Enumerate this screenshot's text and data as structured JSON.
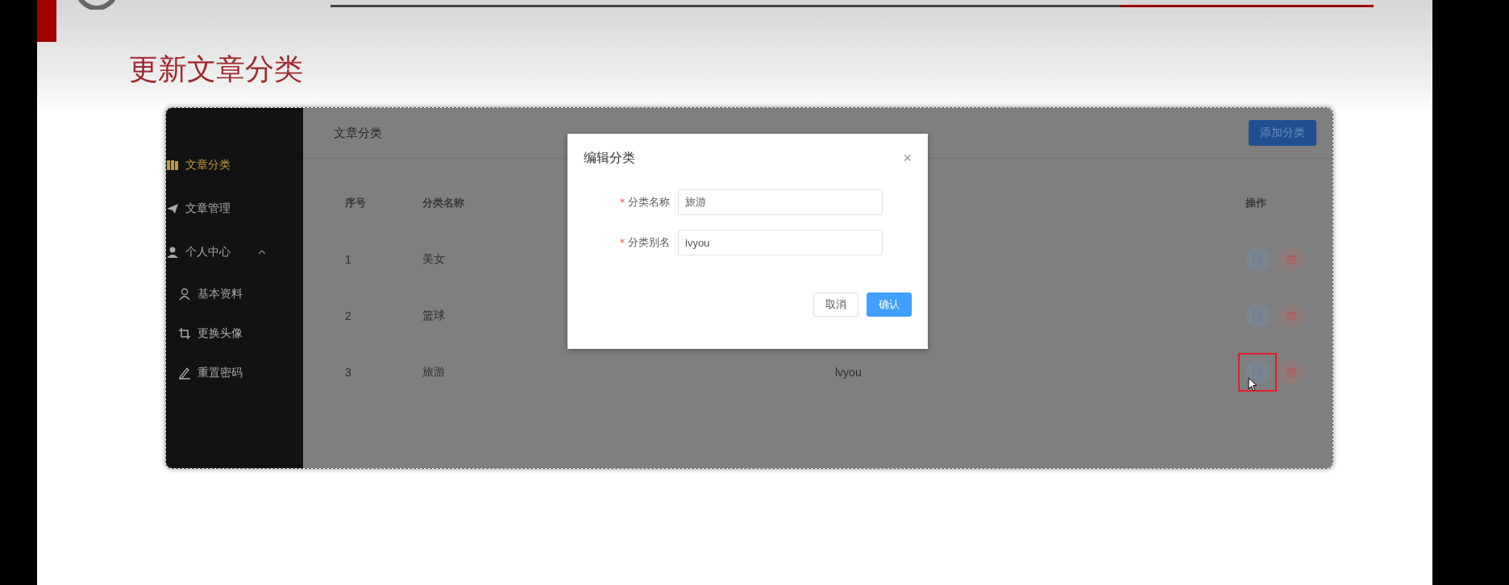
{
  "slide": {
    "title": "更新文章分类"
  },
  "app": {
    "sidebar": {
      "items": [
        {
          "label": "文章分类",
          "selected": true
        },
        {
          "label": "文章管理",
          "selected": false
        },
        {
          "label": "个人中心",
          "selected": false,
          "expanded": true,
          "children": [
            {
              "label": "基本资料",
              "selected": false
            },
            {
              "label": "更换头像",
              "selected": false
            },
            {
              "label": "重置密码",
              "selected": false
            }
          ]
        }
      ]
    },
    "header": {
      "title": "文章分类",
      "add_button": "添加分类"
    },
    "table": {
      "columns": [
        "序号",
        "分类名称",
        "操作"
      ],
      "rows": [
        {
          "index": "1",
          "name": "美女",
          "edit_highlighted": false
        },
        {
          "index": "2",
          "name": "篮球",
          "edit_highlighted": false
        },
        {
          "index": "3",
          "name": "旅游",
          "alias": "lvyou",
          "edit_highlighted": true
        }
      ]
    },
    "dialog": {
      "title": "编辑分类",
      "close": "×",
      "fields": [
        {
          "label": "分类名称",
          "required": true,
          "value": "旅游"
        },
        {
          "label": "分类别名",
          "required": true,
          "value": "lvyou"
        }
      ],
      "buttons": [
        {
          "label": "取消",
          "kind": "default"
        },
        {
          "label": "确认",
          "kind": "primary"
        }
      ]
    }
  }
}
